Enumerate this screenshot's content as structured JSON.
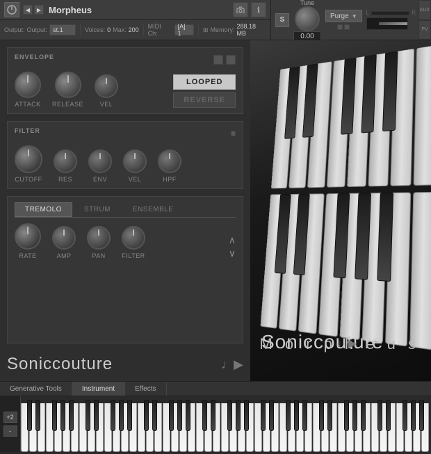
{
  "topbar": {
    "title": "Morpheus",
    "output_label": "Output:",
    "output_value": "st.1",
    "voices_label": "Voices:",
    "voices_value": "0",
    "max_label": "Max:",
    "max_value": "200",
    "purge_label": "Purge",
    "midi_label": "MIDI Ch:",
    "midi_value": "[A] 1",
    "memory_label": "Memory:",
    "memory_value": "288.18 MB",
    "tune_label": "Tune",
    "tune_value": "0.00",
    "aux_label": "AUX",
    "pv_label": "PV"
  },
  "envelope": {
    "section_label": "ENVELOPE",
    "attack_label": "ATTACK",
    "release_label": "RELEASE",
    "vel_label": "VEL",
    "looped_label": "LOOPED",
    "reverse_label": "REVERSE"
  },
  "filter": {
    "section_label": "FILTER",
    "cutoff_label": "CUTOFF",
    "res_label": "RES",
    "env_label": "ENV",
    "vel_label": "VEL",
    "hpf_label": "HPF"
  },
  "modulation": {
    "tremolo_label": "TREMOLO",
    "strum_label": "STRUM",
    "ensemble_label": "ENSEMBLE",
    "rate_label": "RATE",
    "amp_label": "AMP",
    "pan_label": "PAN",
    "filter_label": "FILTER"
  },
  "branding": {
    "company": "Soniccouture",
    "instrument": "M o r p h e u s"
  },
  "bottom_tabs": {
    "generative": "Generative Tools",
    "instrument": "Instrument",
    "effects": "Effects"
  },
  "keyboard": {
    "octave_label": "+2",
    "minus_label": "-"
  },
  "icons": {
    "arrow_left": "◀",
    "arrow_right": "▶",
    "camera": "📷",
    "info": "ℹ",
    "note": "♩▶",
    "filter_menu": "≡",
    "wave_up": "∧",
    "wave_down": "∨"
  }
}
